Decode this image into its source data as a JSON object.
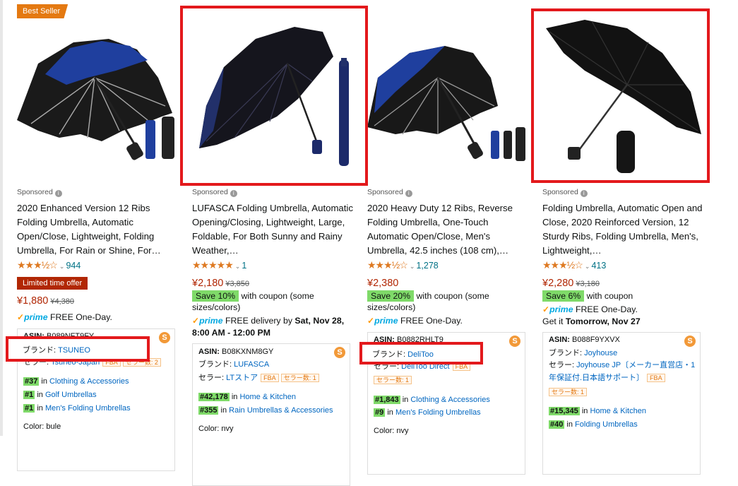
{
  "colors": {
    "highlight_box": "#e3191c",
    "rank_green": "#7fda69",
    "price_red": "#b12704",
    "link_blue": "#007185"
  },
  "products": [
    {
      "best_seller": "Best Seller",
      "sponsored": "Sponsored",
      "title": "2020 Enhanced Version 12 Ribs Folding Umbrella, Automatic Open/Close, Lightweight, Folding Umbrella, For Rain or Shine, For…",
      "stars": "★★★½☆",
      "rating_count": "944",
      "limited_deal": "Limited time offer",
      "price": "¥1,880",
      "old_price": "¥4,380",
      "prime": "prime",
      "delivery": "FREE One-Day.",
      "info": {
        "asin_label": "ASIN:",
        "asin": "B089NFT9FY",
        "brand_label": "ブランド:",
        "brand": "TSUNEO",
        "seller_label": "セラー:",
        "seller": "Tsuneo-Japan",
        "fba": "FBA",
        "sellers": "セラー数: 2",
        "ranks": [
          {
            "rank": "#37",
            "in": "in",
            "cat": "Clothing & Accessories"
          },
          {
            "rank": "#1",
            "in": "in",
            "cat": "Golf Umbrellas"
          },
          {
            "rank": "#1",
            "in": "in",
            "cat": "Men's Folding Umbrellas"
          }
        ],
        "color_label": "Color:",
        "color": "bule"
      }
    },
    {
      "sponsored": "Sponsored",
      "title": "LUFASCA Folding Umbrella, Automatic Opening/Closing, Lightweight, Large, Foldable, For Both Sunny and Rainy Weather,…",
      "stars": "★★★★★",
      "rating_count": "1",
      "price": "¥2,180",
      "old_price": "¥3,850",
      "save": "Save 10%",
      "save_text": "with coupon (some sizes/colors)",
      "prime": "prime",
      "delivery": "FREE delivery by",
      "delivery_date": "Sat, Nov 28, 8:00 AM - 12:00 PM",
      "info": {
        "asin_label": "ASIN:",
        "asin": "B08KXNM8GY",
        "brand_label": "ブランド:",
        "brand": "LUFASCA",
        "seller_label": "セラー:",
        "seller": "LTストア",
        "fba": "FBA",
        "sellers": "セラー数: 1",
        "ranks": [
          {
            "rank": "#42,178",
            "in": "in",
            "cat": "Home & Kitchen"
          },
          {
            "rank": "#355",
            "in": "in",
            "cat": "Rain Umbrellas & Accessories"
          }
        ],
        "color_label": "Color:",
        "color": "nvy"
      }
    },
    {
      "sponsored": "Sponsored",
      "title": "2020 Heavy Duty 12 Ribs, Reverse Folding Umbrella, One-Touch Automatic Open/Close, Men's Umbrella, 42.5 inches (108 cm),…",
      "stars": "★★★½☆",
      "rating_count": "1,278",
      "price": "¥2,380",
      "save": "Save 20%",
      "save_text": "with coupon (some sizes/colors)",
      "prime": "prime",
      "delivery": "FREE One-Day.",
      "info": {
        "asin_label": "ASIN:",
        "asin": "B0882RHLT9",
        "brand_label": "ブランド:",
        "brand": "DeliToo",
        "seller_label": "セラー:",
        "seller": "DeliToo Direct",
        "fba": "FBA",
        "sellers": "セラー数: 1",
        "ranks": [
          {
            "rank": "#1,843",
            "in": "in",
            "cat": "Clothing & Accessories"
          },
          {
            "rank": "#9",
            "in": "in",
            "cat": "Men's Folding Umbrellas"
          }
        ],
        "color_label": "Color:",
        "color": "nvy"
      }
    },
    {
      "sponsored": "Sponsored",
      "title": "Folding Umbrella, Automatic Open and Close, 2020 Reinforced Version, 12 Sturdy Ribs, Folding Umbrella, Men's, Lightweight,…",
      "stars": "★★★½☆",
      "rating_count": "413",
      "price": "¥2,280",
      "old_price": "¥3,180",
      "save": "Save 6%",
      "save_text": "with coupon",
      "prime": "prime",
      "delivery": "FREE One-Day.",
      "get_it": "Get it",
      "get_it_date": "Tomorrow, Nov 27",
      "info": {
        "asin_label": "ASIN:",
        "asin": "B088F9YXVX",
        "brand_label": "ブランド:",
        "brand": "Joyhouse",
        "seller_label": "セラー:",
        "seller": "Joyhouse JP〔メーカー直営店・1年保証付.日本語サポート〕",
        "seller_line1": "Joyhouse JP〔メーカー直営店・1",
        "seller_line2": "年保証付.日本語サポート〕",
        "fba": "FBA",
        "sellers": "セラー数: 1",
        "ranks": [
          {
            "rank": "#15,345",
            "in": "in",
            "cat": "Home & Kitchen"
          },
          {
            "rank": "#40",
            "in": "in",
            "cat": "Folding Umbrellas"
          }
        ]
      }
    }
  ]
}
